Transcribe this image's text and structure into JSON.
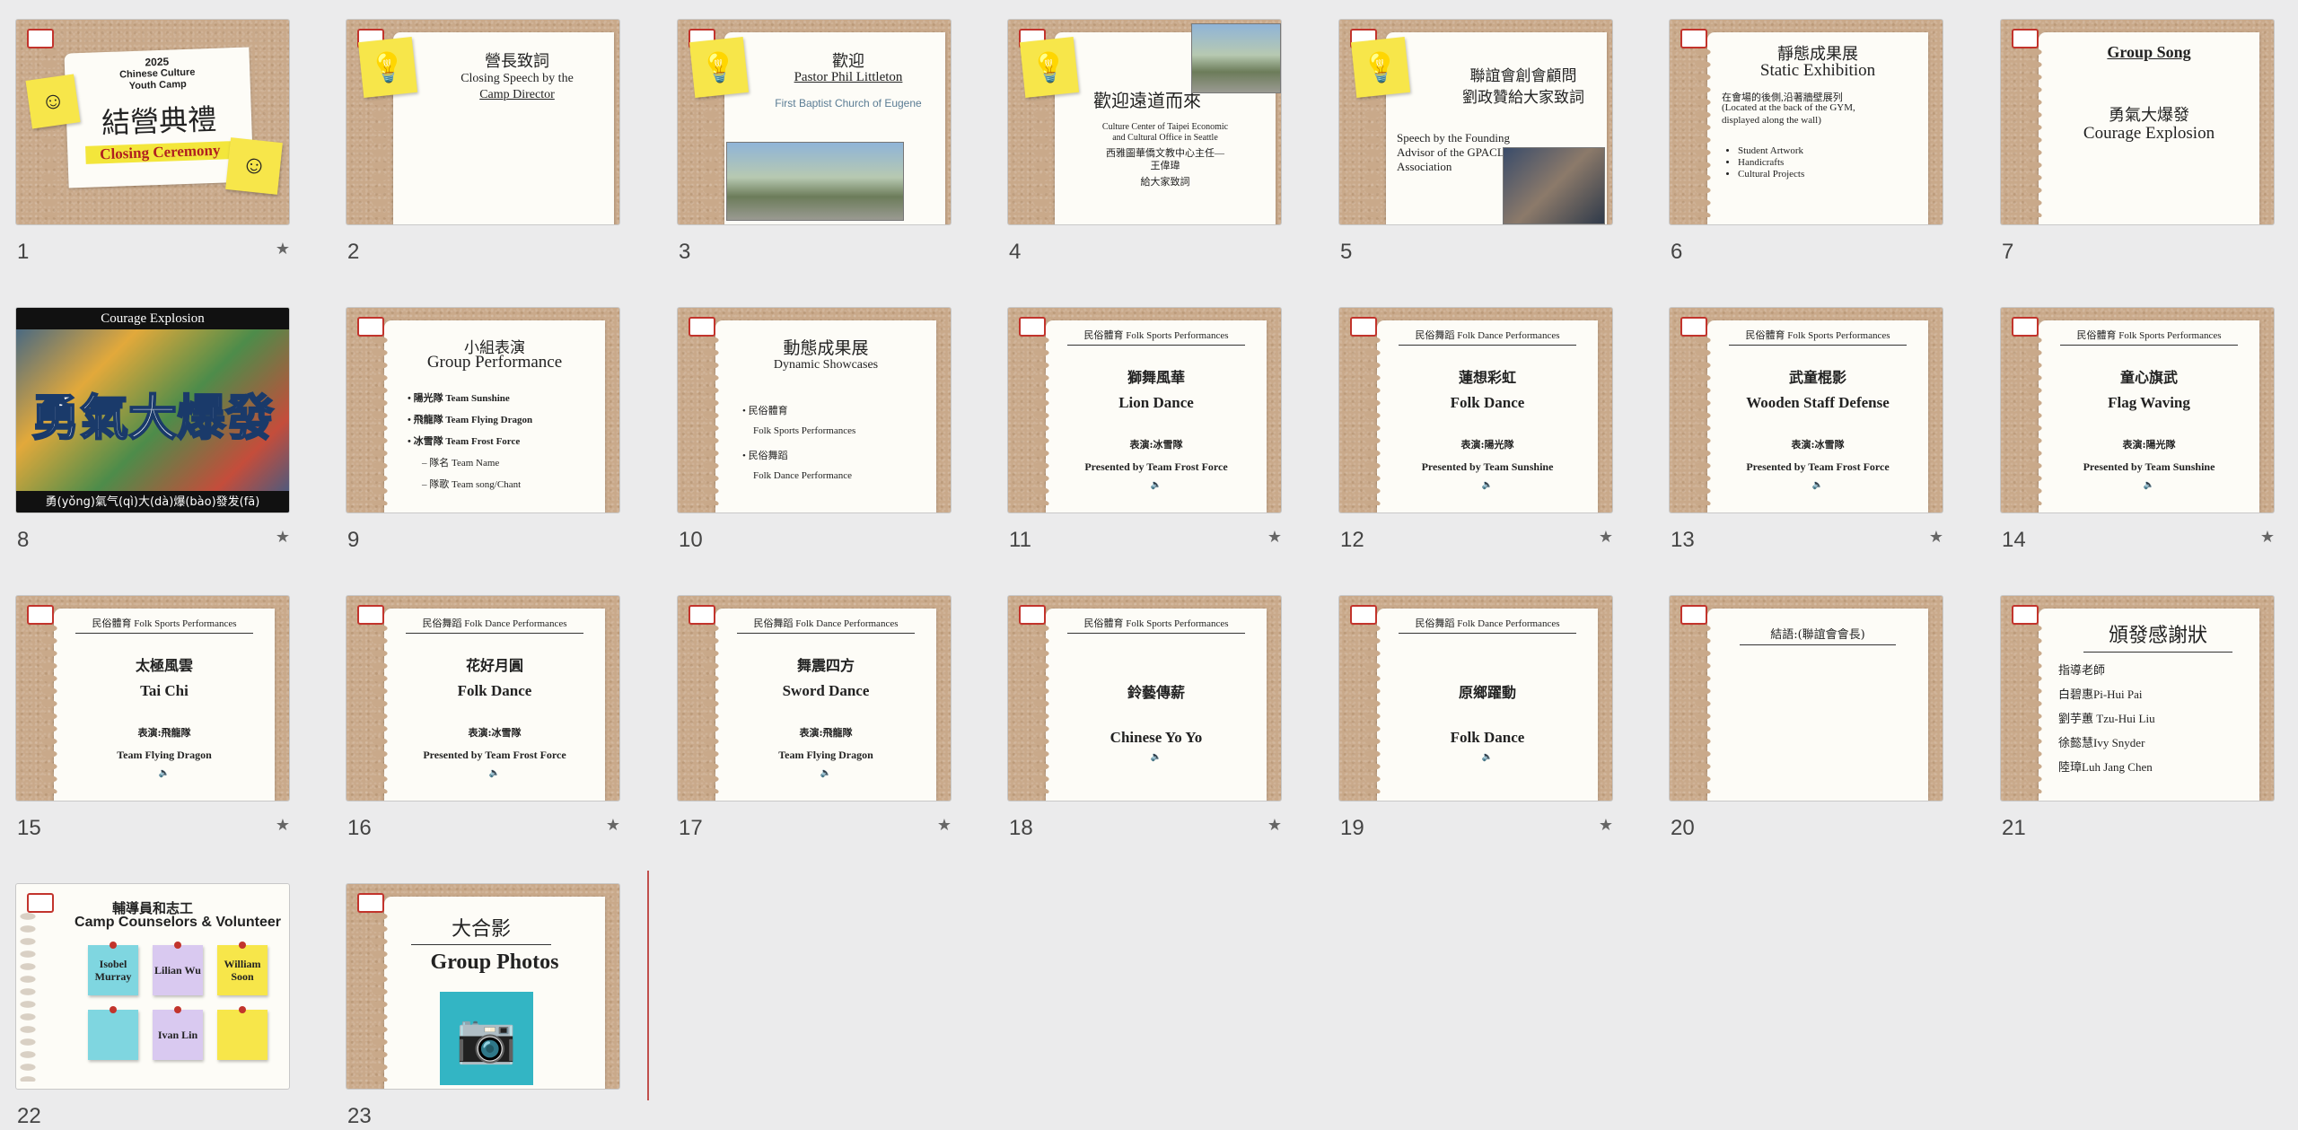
{
  "slides": [
    {
      "num": "1",
      "star": "★",
      "kind": "cover",
      "year": "2025",
      "line1": "Chinese Culture",
      "line2": "Youth Camp",
      "cn": "結營典禮",
      "en": "Closing Ceremony"
    },
    {
      "num": "2",
      "star": "",
      "kind": "bulb-text",
      "cn": "營長致詞",
      "en1": "Closing Speech by the",
      "en2": "Camp Director"
    },
    {
      "num": "3",
      "star": "",
      "kind": "welcome",
      "cn": "歡迎",
      "en": "Pastor Phil Littleton",
      "sub": "First Baptist Church of Eugene"
    },
    {
      "num": "4",
      "star": "",
      "kind": "guest",
      "cn": "歡迎遠道而來",
      "l1": "Culture Center of Taipei Economic",
      "l2": "and Cultural Office in Seattle",
      "l3": "西雅圖華僑文教中心主任—",
      "l4": "王偉瑋",
      "l5": "給大家致詞"
    },
    {
      "num": "5",
      "star": "",
      "kind": "advisor",
      "cn1": "聯誼會創會顧問",
      "cn2": "劉政贊給大家致詞",
      "en1": "Speech by the Founding",
      "en2": "Advisor of the GPACLS",
      "en3": "Association"
    },
    {
      "num": "6",
      "star": "",
      "kind": "static",
      "cn": "靜態成果展",
      "en": "Static Exhibition",
      "d1": "在會場的後側,沿著牆壁展列",
      "d2": "(Located at the back of the GYM,",
      "d3": "displayed along the wall)",
      "bullets": [
        "Student Artwork",
        "Handicrafts",
        "Cultural Projects"
      ]
    },
    {
      "num": "7",
      "star": "",
      "kind": "song",
      "en": "Group Song",
      "cn": "勇氣大爆發",
      "en2": "Courage Explosion"
    },
    {
      "num": "8",
      "star": "★",
      "kind": "video",
      "top": "Courage Explosion",
      "cn": "勇氣大爆發",
      "bottom": "勇(yǒng)氣气(qì)大(dà)爆(bào)發发(fā)"
    },
    {
      "num": "9",
      "star": "",
      "kind": "group",
      "cn": "小組表演",
      "en": "Group Performance",
      "items": [
        "• 陽光隊 Team Sunshine",
        "• 飛龍隊 Team Flying Dragon",
        "• 冰雪隊 Team Frost Force",
        "– 隊名  Team Name",
        "– 隊歌  Team song/Chant"
      ]
    },
    {
      "num": "10",
      "star": "",
      "kind": "dynamic",
      "cn": "動態成果展",
      "en": "Dynamic Showcases",
      "items": [
        "• 民俗體育",
        "Folk Sports Performances",
        "• 民俗舞蹈",
        "Folk Dance Performance"
      ]
    },
    {
      "num": "11",
      "star": "★",
      "kind": "perf",
      "header": "民俗體育  Folk Sports Performances",
      "cn": "獅舞風華",
      "en": "Lion Dance",
      "by_cn": "表演:冰雪隊",
      "by_en": "Presented by Team Frost Force"
    },
    {
      "num": "12",
      "star": "★",
      "kind": "perf",
      "header": "民俗舞蹈  Folk Dance Performances",
      "cn": "蓮想彩虹",
      "en": "Folk Dance",
      "by_cn": "表演:陽光隊",
      "by_en": "Presented by Team Sunshine"
    },
    {
      "num": "13",
      "star": "★",
      "kind": "perf",
      "header": "民俗體育  Folk Sports Performances",
      "cn": "武童棍影",
      "en": "Wooden Staff Defense",
      "by_cn": "表演:冰雪隊",
      "by_en": "Presented by Team Frost Force"
    },
    {
      "num": "14",
      "star": "★",
      "kind": "perf",
      "header": "民俗體育  Folk Sports Performances",
      "cn": "童心旗武",
      "en": "Flag Waving",
      "by_cn": "表演:陽光隊",
      "by_en": "Presented by Team Sunshine"
    },
    {
      "num": "15",
      "star": "★",
      "kind": "perf",
      "header": "民俗體育  Folk Sports Performances",
      "cn": "太極風雲",
      "en": "Tai Chi",
      "by_cn": "表演:飛龍隊",
      "by_en": "Team Flying Dragon"
    },
    {
      "num": "16",
      "star": "★",
      "kind": "perf",
      "header": "民俗舞蹈  Folk Dance Performances",
      "cn": "花好月圓",
      "en": "Folk Dance",
      "by_cn": "表演:冰雪隊",
      "by_en": "Presented by Team Frost Force"
    },
    {
      "num": "17",
      "star": "★",
      "kind": "perf",
      "header": "民俗舞蹈  Folk Dance Performances",
      "cn": "舞震四方",
      "en": "Sword Dance",
      "by_cn": "表演:飛龍隊",
      "by_en": "Team Flying Dragon"
    },
    {
      "num": "18",
      "star": "★",
      "kind": "perf2",
      "header": "民俗體育  Folk Sports Performances",
      "cn": "鈴藝傳薪",
      "en": "Chinese Yo Yo"
    },
    {
      "num": "19",
      "star": "★",
      "kind": "perf2",
      "header": "民俗舞蹈  Folk Dance Performances",
      "cn": "原鄉躍動",
      "en": "Folk Dance"
    },
    {
      "num": "20",
      "star": "",
      "kind": "closing",
      "header": "結語:(聯誼會會長)"
    },
    {
      "num": "21",
      "star": "",
      "kind": "awards",
      "cn": "頒發感謝狀",
      "items": [
        "指導老師",
        "白碧惠Pi-Hui Pai",
        "劉芋蕙 Tzu-Hui Liu",
        "徐懿慧Ivy Snyder",
        "陸璋Luh Jang Chen"
      ]
    },
    {
      "num": "22",
      "star": "",
      "kind": "counselors",
      "cn": "輔導員和志工",
      "en": "Camp Counselors & Volunteer",
      "notes": [
        "Isobel Murray",
        "Lilian Wu",
        "William Soon",
        "",
        "Ivan Lin",
        ""
      ]
    },
    {
      "num": "23",
      "star": "",
      "kind": "photos",
      "cn": "大合影",
      "en": "Group Photos"
    }
  ],
  "colors": {
    "accent": "#c0504d",
    "sticky_yellow": "#f7e64a",
    "sticky_blue": "#7fd6e0",
    "sticky_purple": "#d9c9f0"
  }
}
